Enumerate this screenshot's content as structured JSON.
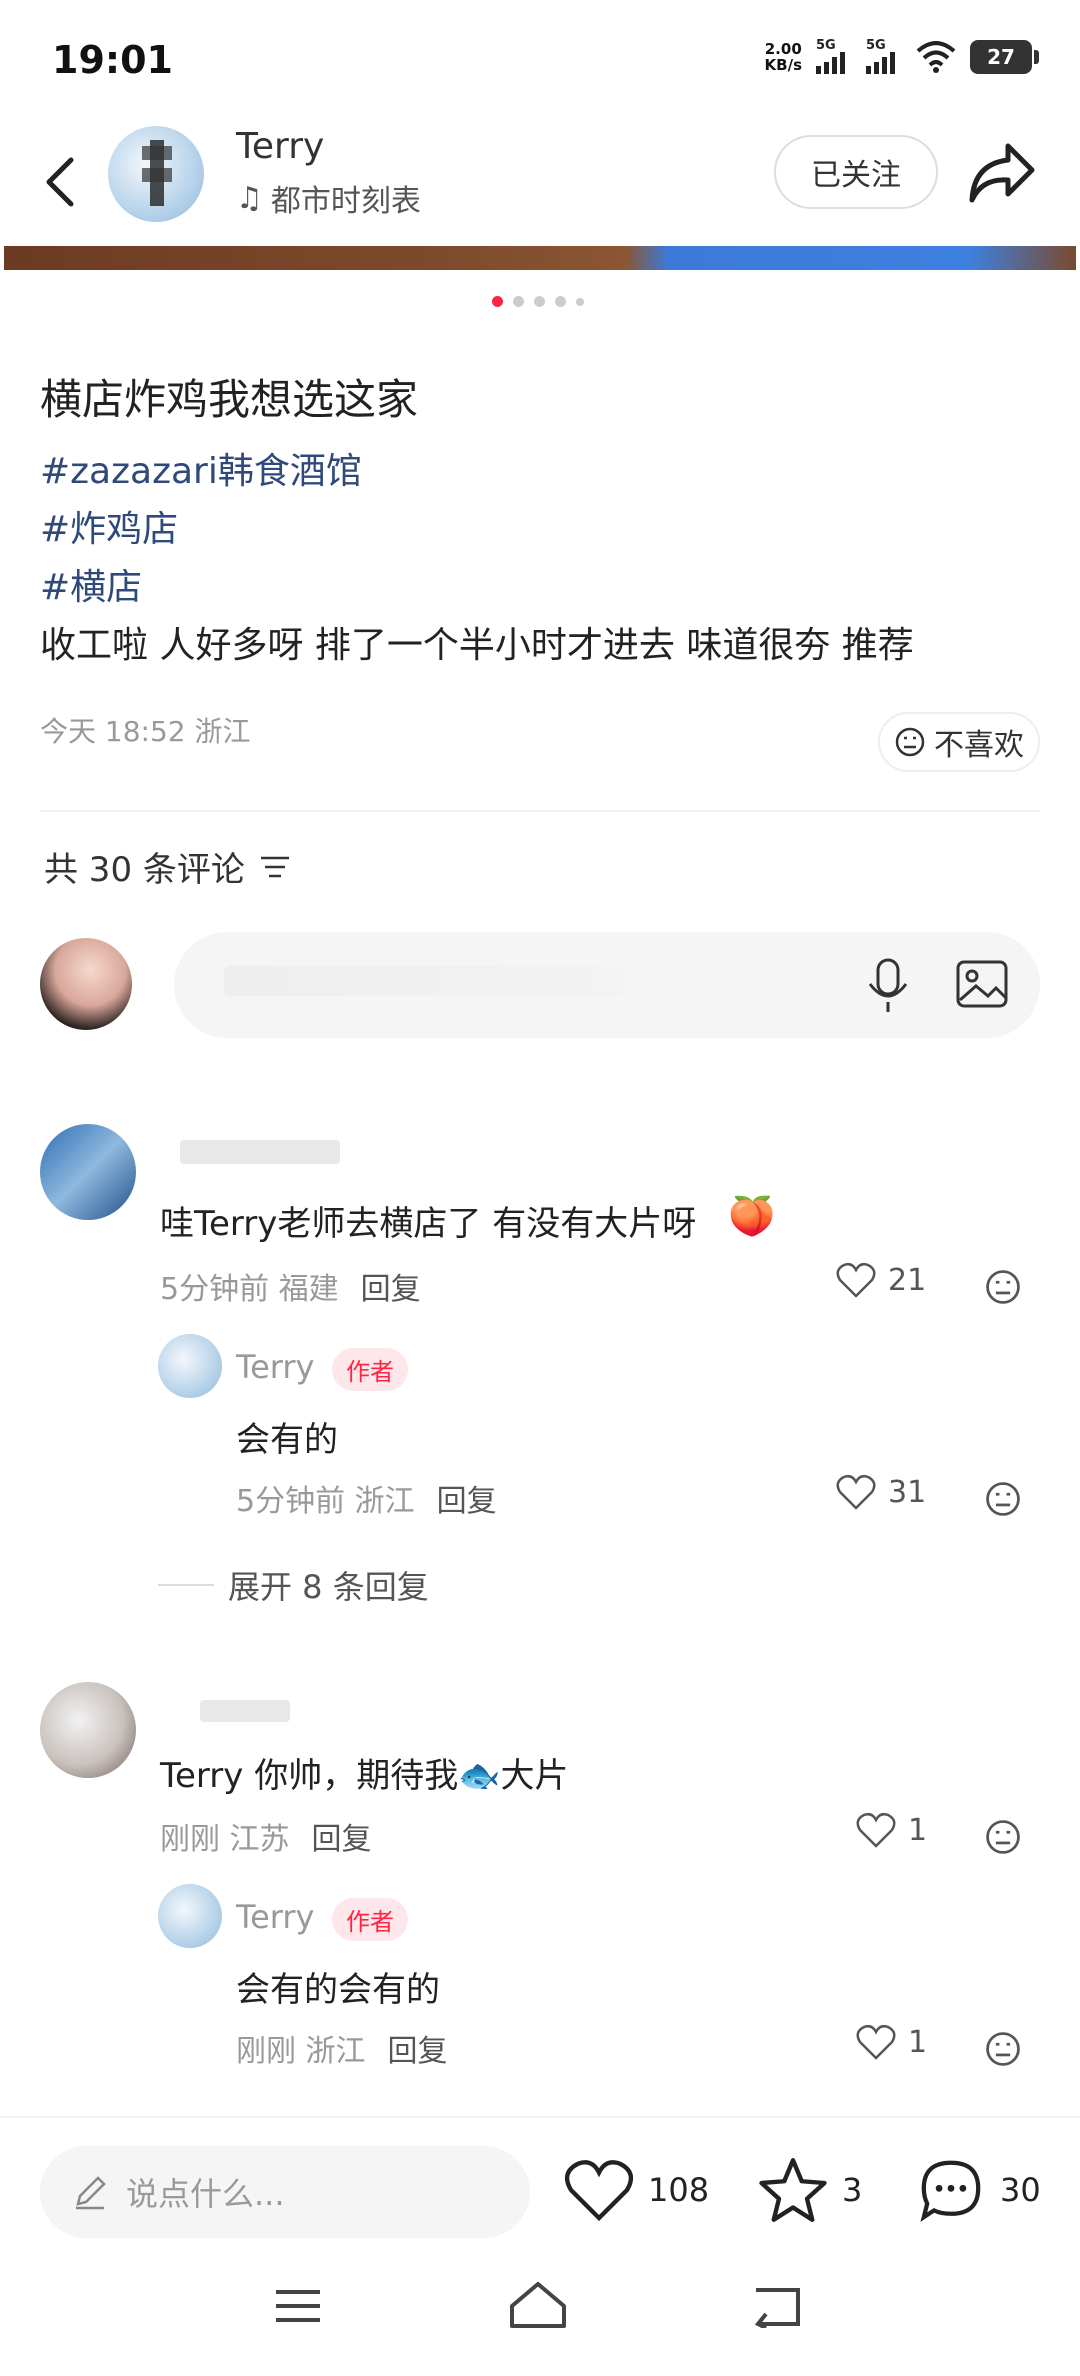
{
  "status": {
    "time": "19:01",
    "net_speed": "2.00",
    "net_unit": "KB/s",
    "sig1": "5G",
    "sig2": "5G",
    "battery": "27"
  },
  "header": {
    "author": "Terry",
    "music": "都市时刻表",
    "follow_label": "已关注"
  },
  "post": {
    "title": "横店炸鸡我想选这家",
    "tags": [
      "#zazazari韩食酒馆",
      "#炸鸡店",
      "#横店"
    ],
    "body": "收工啦 人好多呀 排了一个半小时才进去 味道很夯 推荐",
    "meta": "今天 18:52 浙江",
    "dislike_label": "不喜欢"
  },
  "comments_header": {
    "label": "共 30 条评论"
  },
  "comments": [
    {
      "text": "哇Terry老师去横店了 有没有大片呀",
      "time": "5分钟前 福建",
      "reply_label": "回复",
      "likes": "21",
      "reply": {
        "name": "Terry",
        "badge": "作者",
        "text": "会有的",
        "time": "5分钟前 浙江",
        "reply_label": "回复",
        "likes": "31"
      },
      "expand_label": "展开 8 条回复"
    },
    {
      "text": "Terry 你帅，期待我🐟大片",
      "time": "刚刚 江苏",
      "reply_label": "回复",
      "likes": "1",
      "reply": {
        "name": "Terry",
        "badge": "作者",
        "text": "会有的会有的",
        "time": "刚刚 浙江",
        "reply_label": "回复",
        "likes": "1"
      }
    }
  ],
  "bottom": {
    "placeholder": "说点什么...",
    "likes": "108",
    "stars": "3",
    "comments": "30"
  },
  "colors": {
    "accent": "#ff2442",
    "tag": "#2f4a7a"
  }
}
